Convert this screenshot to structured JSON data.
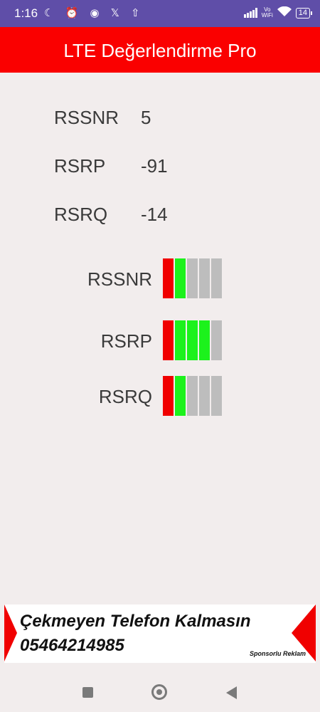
{
  "status": {
    "time": "1:16",
    "left_icons": "☾ ⏰ ◉ 𝕏 ⇧",
    "vowifi_top": "Vo",
    "vowifi_bottom": "WiFi",
    "battery": "14"
  },
  "app": {
    "title": "LTE Değerlendirme Pro"
  },
  "values": [
    {
      "label": "RSSNR",
      "value": "5"
    },
    {
      "label": "RSRP",
      "value": "-91"
    },
    {
      "label": "RSRQ",
      "value": "-14"
    }
  ],
  "meters": [
    {
      "label": "RSSNR",
      "level": 2,
      "segments": 5
    },
    {
      "label": "RSRP",
      "level": 4,
      "segments": 5
    },
    {
      "label": "RSRQ",
      "level": 2,
      "segments": 5
    }
  ],
  "colors": {
    "red": "#f00000",
    "green": "#1cf21c",
    "empty": "#bdbdbd"
  },
  "ad": {
    "line1": "Çekmeyen Telefon Kalmasın",
    "line2": "05464214985",
    "tag": "Sponsorlu Reklam"
  }
}
